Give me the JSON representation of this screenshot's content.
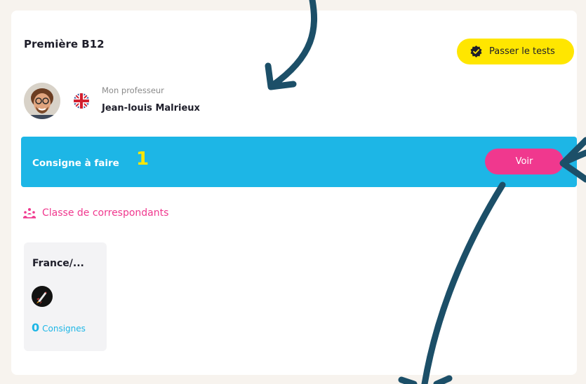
{
  "classroom": {
    "title": "Première B12",
    "pass_tests_label": "Passer le tests"
  },
  "teacher": {
    "label": "Mon professeur",
    "name": "Jean-louis Malrieux",
    "flag": "uk-flag-icon"
  },
  "assignments_banner": {
    "label": "Consigne à faire",
    "count": "1",
    "button_label": "Voir"
  },
  "correspondents": {
    "heading": "Classe de correspondants",
    "icon": "group-icon",
    "classes": [
      {
        "name": "France/...",
        "icon": "rocket-icon",
        "count": "0",
        "count_label": "Consignes"
      }
    ]
  },
  "colors": {
    "accent_blue": "#1db6e6",
    "accent_pink": "#f0388e",
    "accent_yellow": "#ffe600",
    "arrow": "#1c4f68"
  }
}
